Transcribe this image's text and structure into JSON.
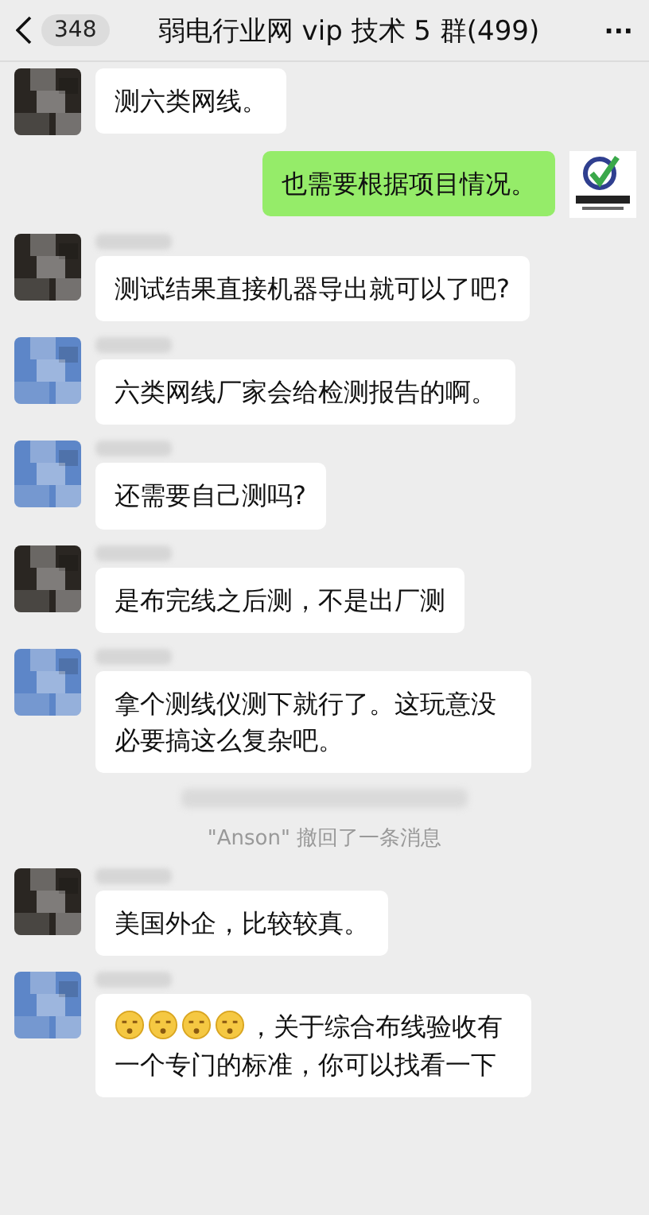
{
  "header": {
    "back_count": "348",
    "title": "弱电行业网 vip 技术 5 群(499)",
    "more": "···"
  },
  "messages": [
    {
      "kind": "continued",
      "color": "#2a2622",
      "text": "测六类网线。"
    },
    {
      "kind": "outgoing",
      "text": "也需要根据项目情况。"
    },
    {
      "kind": "incoming",
      "color": "#2a2622",
      "text": "测试结果直接机器导出就可以了吧?"
    },
    {
      "kind": "incoming",
      "color": "#5d86c8",
      "text": "六类网线厂家会给检测报告的啊。"
    },
    {
      "kind": "incoming",
      "color": "#5d86c8",
      "text": "还需要自己测吗?"
    },
    {
      "kind": "incoming",
      "color": "#2a2622",
      "text": "是布完线之后测，不是出厂测"
    },
    {
      "kind": "incoming",
      "color": "#5d86c8",
      "text": "拿个测线仪测下就行了。这玩意没必要搞这么复杂吧。"
    },
    {
      "kind": "time_blur"
    },
    {
      "kind": "system",
      "text": "\"Anson\" 撤回了一条消息"
    },
    {
      "kind": "incoming",
      "color": "#2a2622",
      "text": "美国外企，比较较真。"
    },
    {
      "kind": "incoming",
      "color": "#5d86c8",
      "icons": [
        {
          "kind": "face"
        },
        {
          "kind": "face"
        },
        {
          "kind": "face"
        },
        {
          "kind": "face"
        }
      ],
      "text": "，关于综合布线验收有一个专门的标准，你可以找看一下"
    }
  ]
}
